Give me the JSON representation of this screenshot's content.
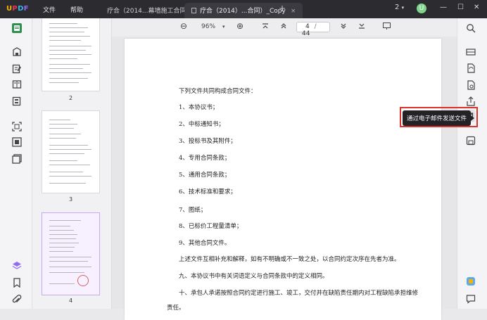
{
  "app": {
    "logo": [
      "U",
      "P",
      "D",
      "F"
    ]
  },
  "menu": {
    "file": "文件",
    "help": "帮助"
  },
  "tabs": [
    {
      "label": "疗合（2014...幕墙施工合同）"
    },
    {
      "label": "疗合（2014）...合同）_Copy",
      "close": "×"
    }
  ],
  "titlebar": {
    "add": "+",
    "count": "2",
    "avatar": "U",
    "minimize": "—",
    "maximize": "☐",
    "close": "✕"
  },
  "toolbar": {
    "zoom_out": "⊖",
    "zoom": "96%",
    "zoom_caret": "▾",
    "zoom_in": "⊕",
    "page_current": "4",
    "page_sep": "/",
    "page_total": "44"
  },
  "thumbnails": [
    {
      "num": "2"
    },
    {
      "num": "3"
    },
    {
      "num": "4"
    }
  ],
  "document": {
    "lines": [
      "下列文件共同构成合同文件：",
      "1、本协议书；",
      "2、中标通知书；",
      "3、投标书及其附件；",
      "4、专用合同条款；",
      "5、通用合同条款；",
      "6、技术标准和要求；",
      "7、图纸；",
      "8、已标价工程量清单；",
      "9、其他合同文件。",
      "上述文件互相补充和解释，如有不明确或不一致之处，以合同约定次序在先者为准。",
      "九、本协议书中有关词语定义与合同条款中的定义相同。",
      "十、承包人承诺按照合同约定进行施工、竣工，交付并在缺陷责任期内对工程缺陷承担维修",
      "责任。"
    ]
  },
  "tooltip": {
    "text": "通过电子邮件发送文件"
  },
  "colors": {
    "accent": "#8f6cf3",
    "highlight": "#e0302a"
  }
}
